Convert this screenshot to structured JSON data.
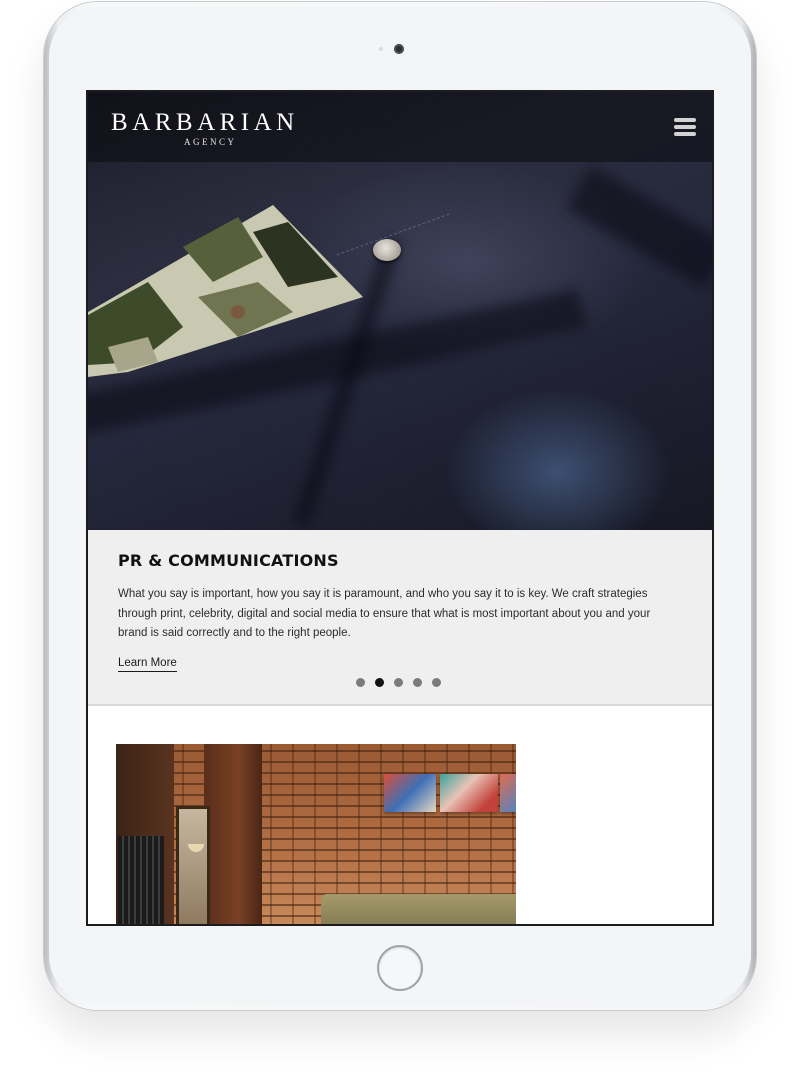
{
  "site": {
    "logo_main": "BARBARIAN",
    "logo_sub": "AGENCY"
  },
  "navbar": {
    "menu_icon": "hamburger-menu-icon"
  },
  "slide": {
    "title": "PR & COMMUNICATIONS",
    "body": "What you say is important, how you say it is paramount, and who you say it to is key. We craft strategies through print, celebrity, digital and social media to ensure that what is most important about you and your brand is said correctly and to the right people.",
    "link_label": "Learn More",
    "pagination": {
      "total": 5,
      "active_index": 1
    }
  },
  "colors": {
    "slide_background": "#efefef",
    "title_color": "#111111",
    "dot_inactive": "#7b7b7b",
    "dot_active": "#141414"
  }
}
